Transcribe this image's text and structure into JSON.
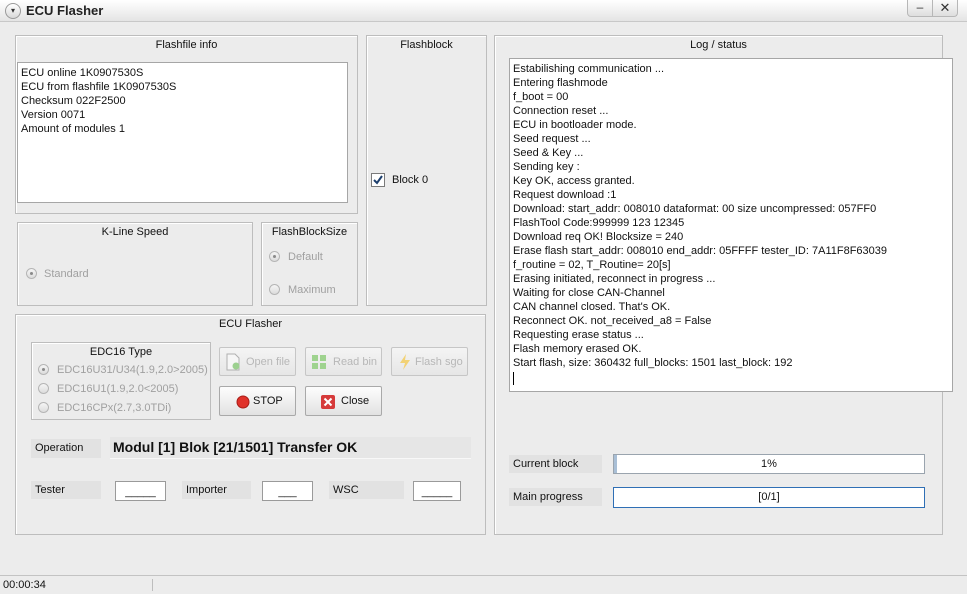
{
  "window": {
    "title": "ECU Flasher",
    "menu_icon": "▾",
    "minimize_icon": "–",
    "close_icon": "✕"
  },
  "flashfile_info": {
    "title": "Flashfile info",
    "lines": [
      "ECU online 1K0907530S",
      "ECU from flashfile 1K0907530S",
      "Checksum 022F2500",
      "Version 0071",
      "Amount of modules 1"
    ]
  },
  "flashblock": {
    "title": "Flashblock",
    "block_label": "Block 0",
    "checked": true
  },
  "kline_speed": {
    "title": "K-Line Speed",
    "option": "Standard"
  },
  "flashblock_size": {
    "title": "FlashBlockSize",
    "options": [
      "Default",
      "Maximum"
    ]
  },
  "ecu_flasher": {
    "title": "ECU Flasher",
    "edc16_type": {
      "title": "EDC16 Type",
      "options": [
        "EDC16U31/U34(1.9,2.0>2005)",
        "EDC16U1(1.9,2.0<2005)",
        "EDC16CPx(2.7,3.0TDi)"
      ]
    },
    "buttons": {
      "open_file": "Open file",
      "read_bin": "Read  bin",
      "flash_sgo": "Flash  sgo",
      "stop": "STOP",
      "close": "Close"
    },
    "operation_label": "Operation",
    "operation_value": "Modul [1] Blok [21/1501] Transfer OK",
    "tester_label": "Tester",
    "tester_value": "_____",
    "importer_label": "Importer",
    "importer_value": "___",
    "wsc_label": "WSC",
    "wsc_value": "_____"
  },
  "log": {
    "title": "Log / status",
    "lines": [
      "Estabilishing communication ...",
      "Entering flashmode",
      "f_boot = 00",
      "Connection reset ...",
      "ECU in bootloader mode.",
      "Seed request ...",
      "Seed & Key ...",
      "Sending key :",
      "Key OK, access granted.",
      "Request download :1",
      "Download: start_addr: 008010 dataformat: 00 size uncompressed: 057FF0",
      "FlashTool Code:999999 123 12345",
      "Download req OK! Blocksize = 240",
      "Erase flash start_addr: 008010 end_addr: 05FFFF tester_ID: 7A11F8F63039",
      "f_routine = 02, T_Routine= 20[s]",
      "Erasing initiated, reconnect in progress ...",
      "Waiting for close CAN-Channel",
      "CAN channel closed. That's OK.",
      "Reconnect OK. not_received_a8 = False",
      "Requesting erase status ...",
      "Flash memory erased OK.",
      "Start flash, size: 360432 full_blocks: 1501 last_block: 192"
    ]
  },
  "progress": {
    "current_block_label": "Current block",
    "current_block_text": "1%",
    "current_block_fraction": 0.01,
    "main_progress_label": "Main progress",
    "main_progress_text": "[0/1]",
    "main_progress_fraction": 0
  },
  "statusbar": {
    "time": "00:00:34"
  },
  "colors": {
    "stop_red": "#e0322a",
    "close_red": "#d63a3a",
    "accent_blue": "#2f6fb5"
  }
}
